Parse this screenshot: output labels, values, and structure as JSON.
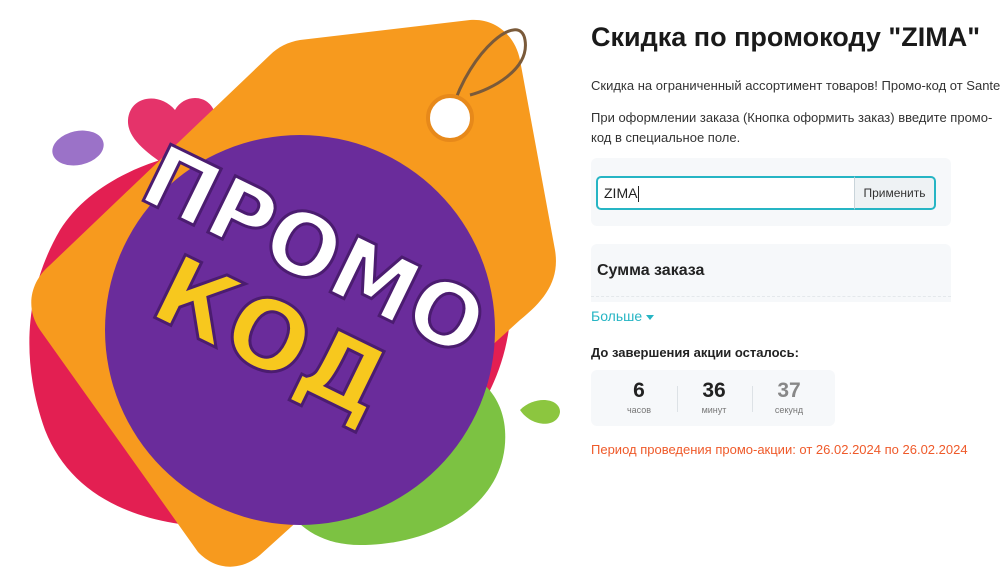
{
  "promo_image": {
    "top_word": "ПРОМО",
    "bottom_word": "КОД",
    "colors": {
      "tag_orange": "#f79a1e",
      "purple": "#6a2c9b",
      "red": "#e31f52",
      "green": "#7cc242",
      "yellow_text": "#f7c81e"
    }
  },
  "page": {
    "title": "Скидка по промокоду \"ZIMA\"",
    "intro": "Скидка на ограниченный ассортимент товаров! Промо-код от Santehnika-online.ru",
    "instruction": "При оформлении заказа (Кнопка оформить заказ) введите промо-код в специальное поле."
  },
  "promo_form": {
    "code_value": "ZIMA",
    "apply_label": "Применить"
  },
  "order_summary": {
    "title": "Сумма заказа",
    "more_label": "Больше"
  },
  "countdown": {
    "label": "До завершения акции осталось:",
    "hours": "6",
    "hours_unit": "часов",
    "minutes": "36",
    "minutes_unit": "минут",
    "seconds": "37",
    "seconds_unit": "секунд"
  },
  "period_text": "Период проведения промо-акции: от 26.02.2024 по 26.02.2024",
  "colors": {
    "accent": "#26b5c4",
    "period": "#ef5a2a"
  }
}
